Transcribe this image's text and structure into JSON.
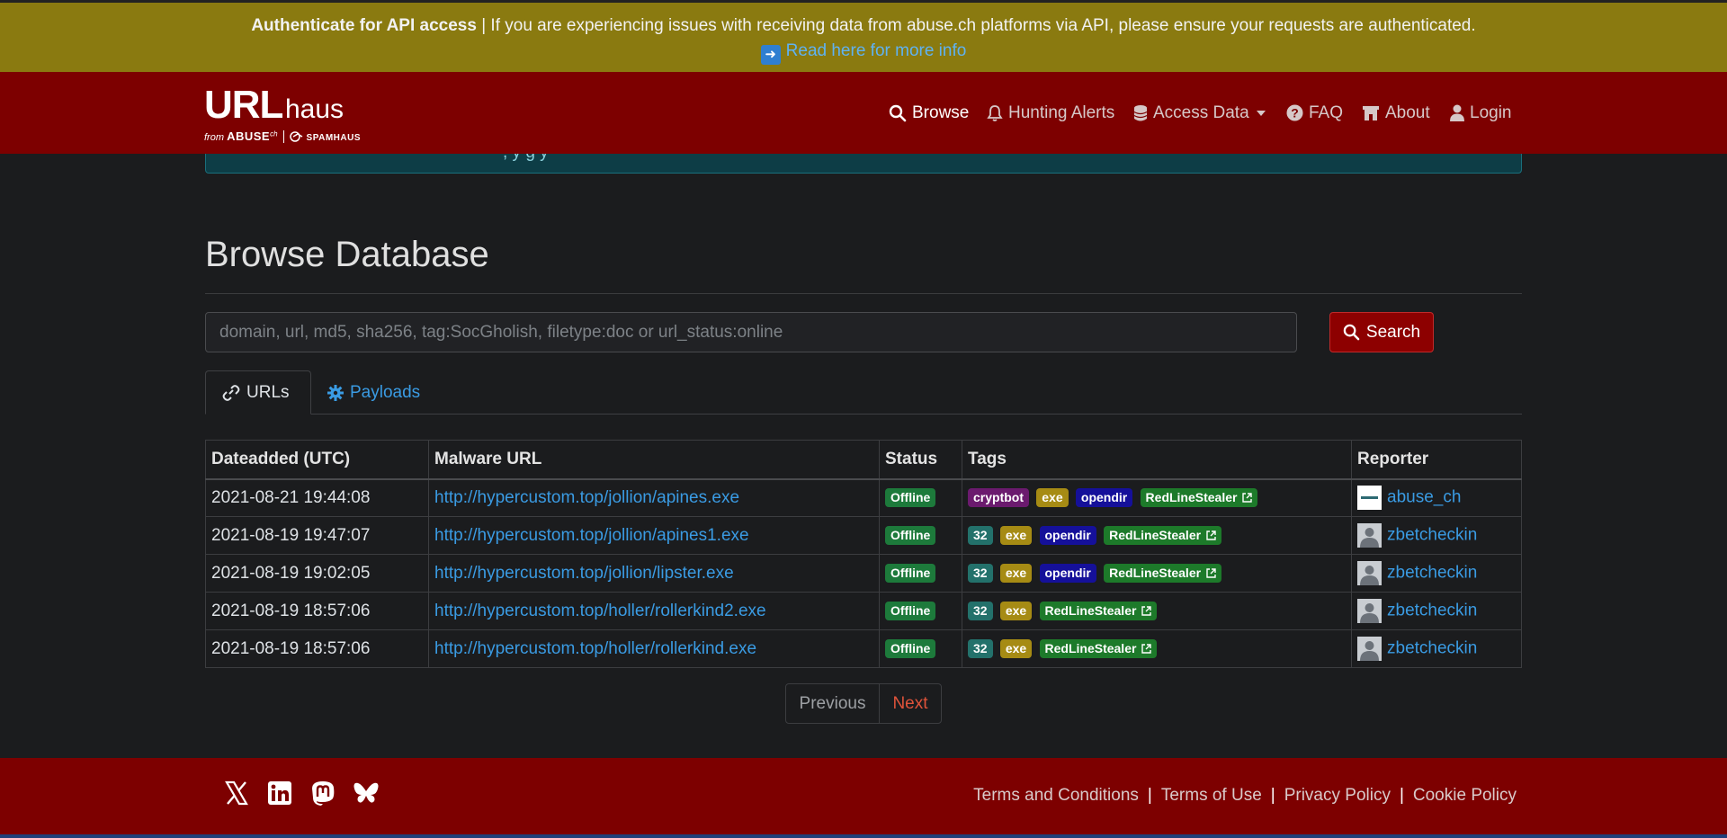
{
  "banner": {
    "title": "Authenticate for API access",
    "message": "| If you are experiencing issues with receiving data from abuse.ch platforms via API, please ensure your requests are authenticated.",
    "link_text": "Read here for more info"
  },
  "brand": {
    "name_bold": "URL",
    "name_light": "haus",
    "from_text": "from",
    "org_one": "ABUSE",
    "org_one_sup": "ch",
    "org_two": "SPAMHAUS"
  },
  "nav": {
    "items": [
      {
        "label": "Browse",
        "icon": "search-icon",
        "active": true
      },
      {
        "label": "Hunting Alerts",
        "icon": "bell-icon"
      },
      {
        "label": "Access Data",
        "icon": "database-icon",
        "dropdown": true
      },
      {
        "label": "FAQ",
        "icon": "question-circle-icon"
      },
      {
        "label": "About",
        "icon": "building-icon"
      },
      {
        "label": "Login",
        "icon": "user-icon"
      }
    ]
  },
  "alert_remnant": {
    "text": ", y               g          y"
  },
  "page": {
    "title": "Browse Database"
  },
  "search": {
    "placeholder": "domain, url, md5, sha256, tag:SocGholish, filetype:doc or url_status:online",
    "value": "",
    "button_label": "Search"
  },
  "tabs": [
    {
      "label": "URLs",
      "icon": "link-icon",
      "active": true
    },
    {
      "label": "Payloads",
      "icon": "gear-icon",
      "active": false
    }
  ],
  "table": {
    "headers": [
      "Dateadded (UTC)",
      "Malware URL",
      "Status",
      "Tags",
      "Reporter"
    ],
    "rows": [
      {
        "date": "2021-08-21 19:44:08",
        "url": "http://hypercustom.top/jollion/apines.exe",
        "status": "Offline",
        "tags": [
          "cryptbot",
          "exe",
          "opendir",
          "RedLineStealer"
        ],
        "reporter": "abuse_ch"
      },
      {
        "date": "2021-08-19 19:47:07",
        "url": "http://hypercustom.top/jollion/apines1.exe",
        "status": "Offline",
        "tags": [
          "32",
          "exe",
          "opendir",
          "RedLineStealer"
        ],
        "reporter": "zbetcheckin"
      },
      {
        "date": "2021-08-19 19:02:05",
        "url": "http://hypercustom.top/jollion/lipster.exe",
        "status": "Offline",
        "tags": [
          "32",
          "exe",
          "opendir",
          "RedLineStealer"
        ],
        "reporter": "zbetcheckin"
      },
      {
        "date": "2021-08-19 18:57:06",
        "url": "http://hypercustom.top/holler/rollerkind2.exe",
        "status": "Offline",
        "tags": [
          "32",
          "exe",
          "RedLineStealer"
        ],
        "reporter": "zbetcheckin"
      },
      {
        "date": "2021-08-19 18:57:06",
        "url": "http://hypercustom.top/holler/rollerkind.exe",
        "status": "Offline",
        "tags": [
          "32",
          "exe",
          "RedLineStealer"
        ],
        "reporter": "zbetcheckin"
      }
    ]
  },
  "pagination": {
    "previous_label": "Previous",
    "next_label": "Next"
  },
  "footer": {
    "social": [
      "x-icon",
      "linkedin-icon",
      "mastodon-icon",
      "bluesky-icon"
    ],
    "links": [
      "Terms and Conditions",
      "Terms of Use",
      "Privacy Policy",
      "Cookie Policy"
    ],
    "separator": "|"
  },
  "colors": {
    "banner_bg": "#8a7a10",
    "navbar_bg": "#7d0000",
    "link": "#3a9be3",
    "offline": "#1d7a3b",
    "cryptbot": "#6b1a6e",
    "exe": "#a68b14",
    "opendir": "#15109a",
    "tag_32": "#23716b",
    "redline": "#1d7a2a"
  }
}
